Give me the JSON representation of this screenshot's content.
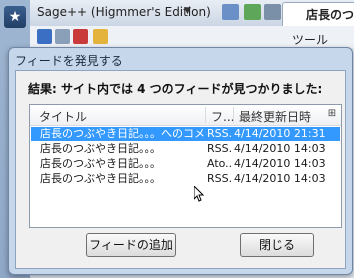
{
  "browser": {
    "title": "Sage++ (Higmmer's Edition)",
    "tab_label": "店長のつぶ",
    "tools_menu": "ツール"
  },
  "dialog": {
    "title": "フィードを発見する",
    "result": "結果: サイト内では 4 つのフィードが見つかりました:",
    "columns": [
      "タイトル",
      "フ...",
      "最終更新日時"
    ],
    "rows": [
      {
        "title": "店長のつぶやき日記。。。へのコメ...",
        "format": "RSS...",
        "date": "4/14/2010 21:31",
        "selected": true
      },
      {
        "title": "店長のつぶやき日記。。。",
        "format": "RSS...",
        "date": "4/14/2010 14:03",
        "selected": false
      },
      {
        "title": "店長のつぶやき日記。。。",
        "format": "Ato...",
        "date": "4/14/2010 14:03",
        "selected": false
      },
      {
        "title": "店長のつぶやき日記。。。",
        "format": "RSS...",
        "date": "4/14/2010 14:03",
        "selected": false
      }
    ],
    "add_button": "フィードの追加",
    "close_button": "閉じる"
  },
  "colors": {
    "selection": "#3399ff",
    "dialog_frame": "#c6d7ec",
    "client_bg": "#f0f0f0"
  },
  "icons": [
    "star-icon",
    "chevron-down-icon",
    "column-chooser-icon",
    "mouse-cursor-icon"
  ]
}
